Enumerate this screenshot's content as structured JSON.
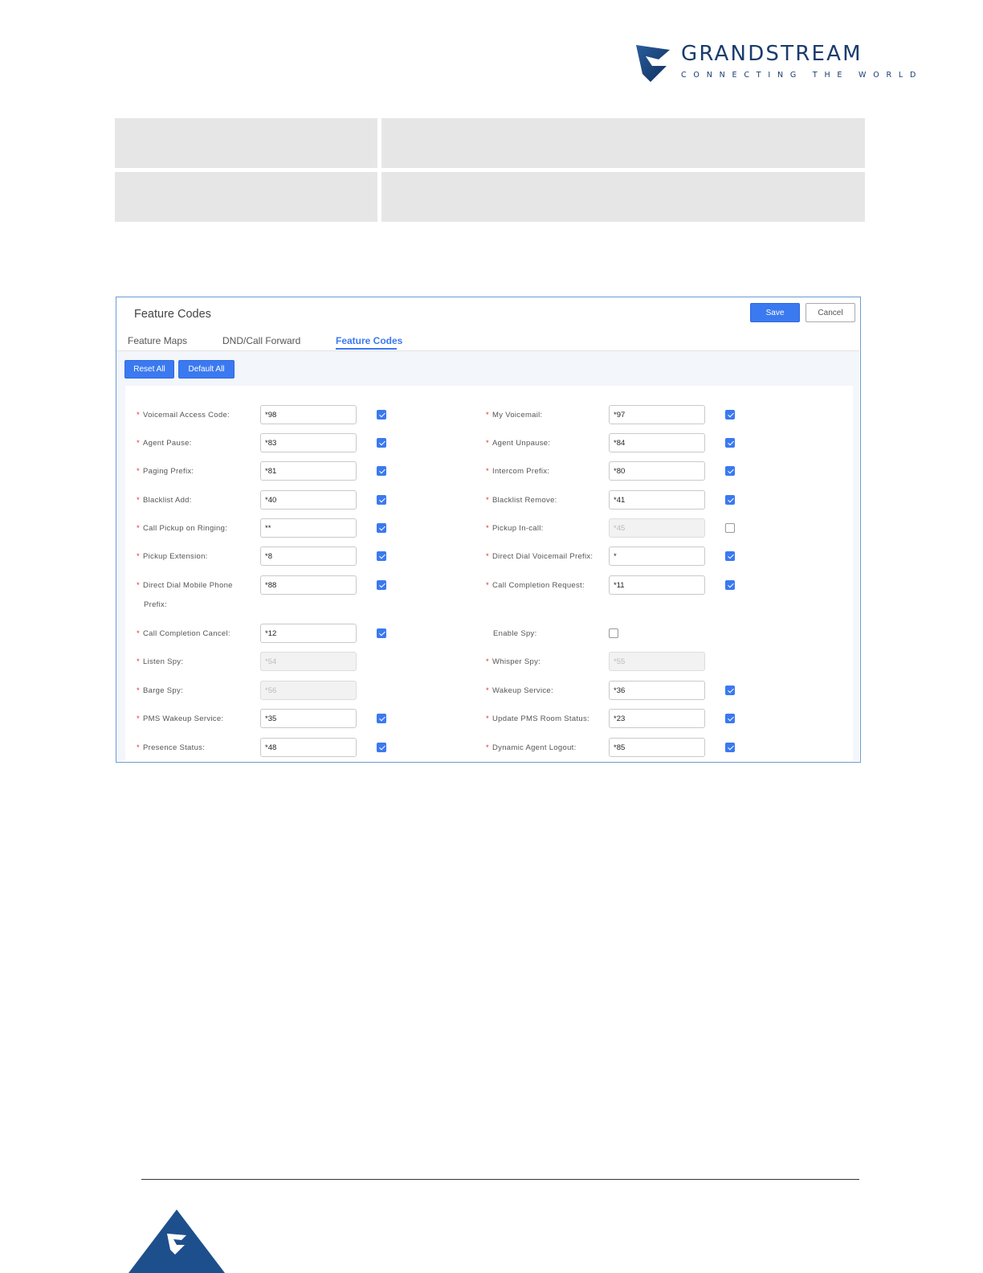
{
  "header": {
    "brand": "GRANDSTREAM",
    "tagline": "CONNECTING THE WORLD",
    "logo_icon": "grandstream-logo-icon",
    "brand_color": "#1a3c6e"
  },
  "table_rows": [
    {
      "label": "",
      "description": ""
    },
    {
      "label": "",
      "description": ""
    }
  ],
  "panel": {
    "title": "Feature Codes",
    "save_label": "Save",
    "cancel_label": "Cancel",
    "tabs": [
      {
        "label": "Feature Maps",
        "active": false
      },
      {
        "label": "DND/Call Forward",
        "active": false
      },
      {
        "label": "Feature Codes",
        "active": true
      }
    ],
    "reset_all_label": "Reset All",
    "default_all_label": "Default All",
    "accent_color": "#3b79f0",
    "fields": {
      "left": [
        {
          "label": "Voicemail Access Code:",
          "value": "*98",
          "enabled": true,
          "checked": true,
          "required": true
        },
        {
          "label": "Agent Pause:",
          "value": "*83",
          "enabled": true,
          "checked": true,
          "required": true
        },
        {
          "label": "Paging Prefix:",
          "value": "*81",
          "enabled": true,
          "checked": true,
          "required": true
        },
        {
          "label": "Blacklist Add:",
          "value": "*40",
          "enabled": true,
          "checked": true,
          "required": true
        },
        {
          "label": "Call Pickup on Ringing:",
          "value": "**",
          "enabled": true,
          "checked": true,
          "required": true
        },
        {
          "label": "Pickup Extension:",
          "value": "*8",
          "enabled": true,
          "checked": true,
          "required": true
        },
        {
          "label": "Direct Dial Mobile Phone",
          "label_line2": "Prefix:",
          "value": "*88",
          "enabled": true,
          "checked": true,
          "required": true
        },
        {
          "label": "Call Completion Cancel:",
          "value": "*12",
          "enabled": true,
          "checked": true,
          "required": true
        },
        {
          "label": "Listen Spy:",
          "value": "*54",
          "enabled": false,
          "required": true
        },
        {
          "label": "Barge Spy:",
          "value": "*56",
          "enabled": false,
          "required": true
        },
        {
          "label": "PMS Wakeup Service:",
          "value": "*35",
          "enabled": true,
          "checked": true,
          "required": true
        },
        {
          "label": "Presence Status:",
          "value": "*48",
          "enabled": true,
          "checked": true,
          "required": true
        }
      ],
      "right": [
        {
          "label": "My Voicemail:",
          "value": "*97",
          "enabled": true,
          "checked": true,
          "required": true
        },
        {
          "label": "Agent Unpause:",
          "value": "*84",
          "enabled": true,
          "checked": true,
          "required": true
        },
        {
          "label": "Intercom Prefix:",
          "value": "*80",
          "enabled": true,
          "checked": true,
          "required": true
        },
        {
          "label": "Blacklist Remove:",
          "value": "*41",
          "enabled": true,
          "checked": true,
          "required": true
        },
        {
          "label": "Pickup In-call:",
          "value": "*45",
          "enabled": false,
          "checked": false,
          "required": true
        },
        {
          "label": "Direct Dial Voicemail Prefix:",
          "value": "*",
          "enabled": true,
          "checked": true,
          "required": true
        },
        {
          "label": "Call Completion Request:",
          "value": "*11",
          "enabled": true,
          "checked": true,
          "required": true
        },
        {
          "label": "Enable Spy:",
          "checkbox_only": true,
          "checked": false,
          "required": false
        },
        {
          "label": "Whisper Spy:",
          "value": "*55",
          "enabled": false,
          "required": true
        },
        {
          "label": "Wakeup Service:",
          "value": "*36",
          "enabled": true,
          "checked": true,
          "required": true
        },
        {
          "label": "Update PMS Room Status:",
          "value": "*23",
          "enabled": true,
          "checked": true,
          "required": true
        },
        {
          "label": "Dynamic Agent Logout:",
          "value": "*85",
          "enabled": true,
          "checked": true,
          "required": true
        }
      ]
    }
  }
}
